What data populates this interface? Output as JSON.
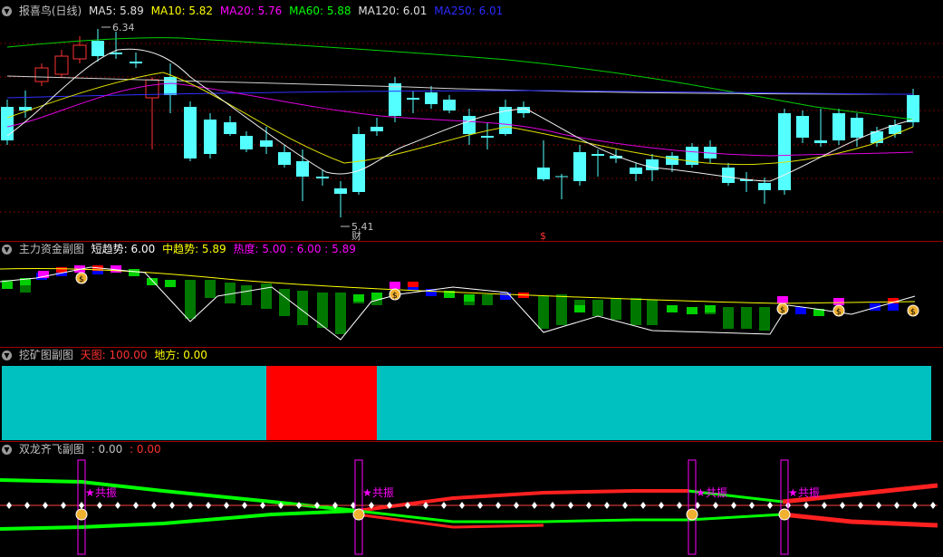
{
  "main_panel": {
    "title": "报喜鸟(日线)",
    "ma_labels": [
      {
        "text": "MA5: 5.89",
        "color": "#e0e0e0"
      },
      {
        "text": "MA10: 5.82",
        "color": "#ffff00"
      },
      {
        "text": "MA20: 5.76",
        "color": "#ff00ff"
      },
      {
        "text": "MA60: 5.88",
        "color": "#00ff00"
      },
      {
        "text": "MA120: 6.01",
        "color": "#e0e0e0"
      },
      {
        "text": "MA250: 6.01",
        "color": "#0000ff"
      }
    ],
    "high_label": "6.34",
    "low_label": "5.41",
    "cai_marker": "财",
    "s_marker": "$"
  },
  "fund_panel": {
    "title": "主力资金副图",
    "short_label": "短趋势: 6.00",
    "mid_label": "中趋势: 5.89",
    "heat_label": "热度: 5.00 : 6.00 : 5.89"
  },
  "mining_panel": {
    "title": "挖矿图副图",
    "sky_label": "天图: 100.00",
    "earth_label": "地方: 0.00"
  },
  "dragon_panel": {
    "title": "双龙齐飞副图",
    "value1": ": 0.00",
    "value2": ": 0.00",
    "resonance_label": "共振"
  },
  "colors": {
    "up": "#ff3232",
    "down": "#54ffff",
    "cyan_fill": "#00c0c0",
    "red_fill": "#ff0000",
    "grid": "#a00000"
  }
}
